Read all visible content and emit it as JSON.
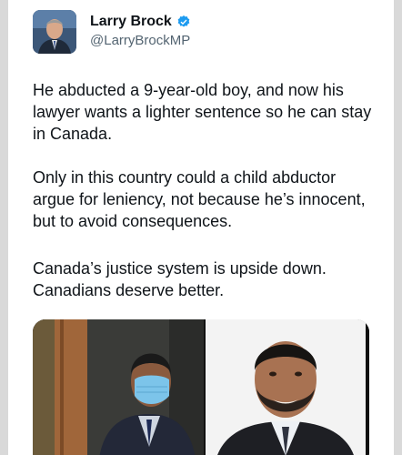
{
  "author": {
    "name": "Larry Brock",
    "handle": "@LarryBrockMP",
    "verified_icon": "verified-badge-icon",
    "verified_color": "#1d9bf0"
  },
  "tweet": {
    "paragraphs": [
      "He abducted a 9-year-old boy, and now his lawyer wants a lighter sentence so he can stay in Canada.",
      "Only in this country could a child abductor argue for leniency, not because he’s innocent, but to avoid consequences.",
      "Canada’s justice system is upside down. Canadians deserve better."
    ]
  },
  "colors": {
    "background": "#d9d9d9",
    "card": "#ffffff",
    "text": "#0f1419",
    "secondary": "#536471"
  }
}
